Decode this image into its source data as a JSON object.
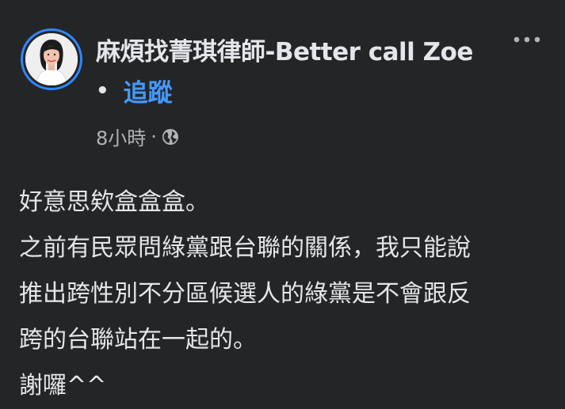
{
  "post": {
    "author": "麻煩找菁琪律師-Better call Zoe",
    "separator_dot": "•",
    "follow_label": "追蹤",
    "timestamp": "8小時",
    "meta_sep": "·",
    "audience_icon": "globe-icon",
    "body_lines": [
      "好意思欸盒盒盒。",
      "之前有民眾問綠黨跟台聯的關係，我只能說",
      "推出跨性別不分區候選人的綠黨是不會跟反",
      "跨的台聯站在一起的。",
      "謝囉^^"
    ]
  },
  "colors": {
    "background": "#242526",
    "text": "#e4e6eb",
    "secondary": "#b0b3b8",
    "link": "#4599ff",
    "avatar_ring": "#2d88ff"
  }
}
